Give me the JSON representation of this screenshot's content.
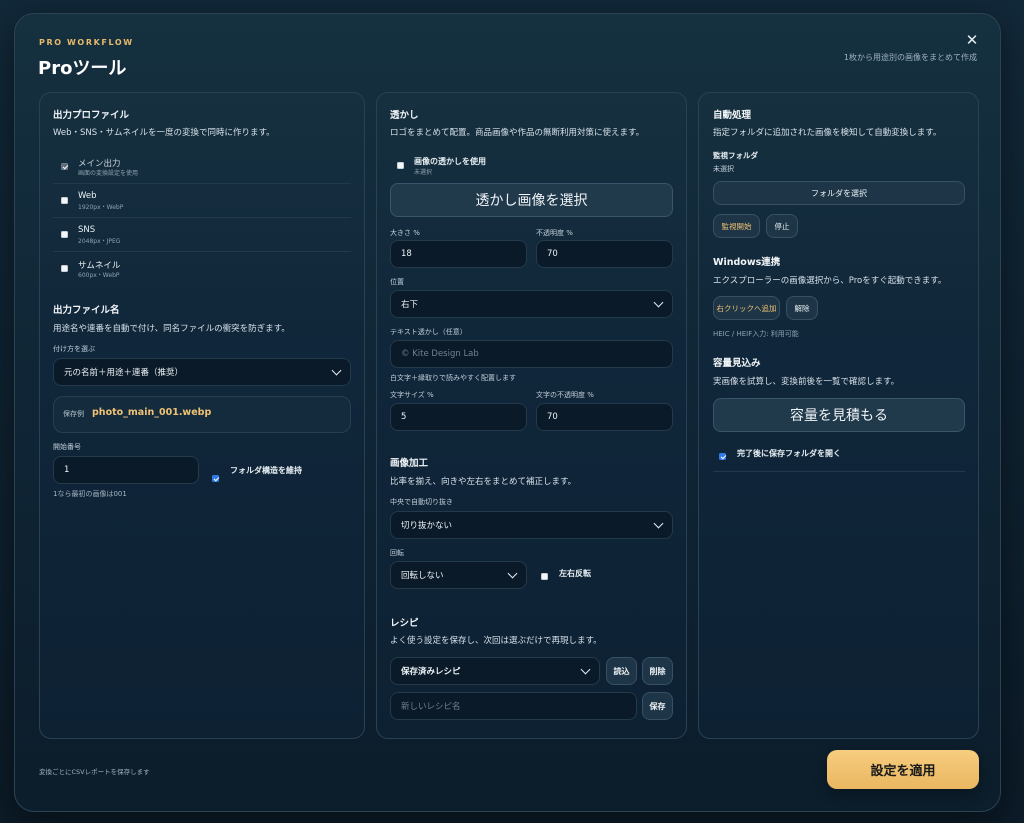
{
  "header": {
    "eyebrow": "PRO WORKFLOW",
    "title": "Proツール",
    "subtitle": "1枚から用途別の画像をまとめて作成",
    "close_icon": "close-icon",
    "close_glyph": "✕"
  },
  "output_profile": {
    "heading": "出力プロファイル",
    "description": "Web・SNS・サムネイルを一度の変換で同時に作ります。",
    "items": [
      {
        "label": "メイン出力",
        "sub": "画面の変換設定を使用",
        "checked": true,
        "disabled": true
      },
      {
        "label": "Web",
        "sub": "1920px・WebP",
        "checked": false
      },
      {
        "label": "SNS",
        "sub": "2048px・JPEG",
        "checked": false
      },
      {
        "label": "サムネイル",
        "sub": "600px・WebP",
        "checked": false
      }
    ]
  },
  "filename": {
    "heading": "出力ファイル名",
    "description": "用途名や連番を自動で付け、同名ファイルの衝突を防ぎます。",
    "method_label": "付け方を選ぶ",
    "method_value": "元の名前＋用途＋連番（推奨）",
    "example_label": "保存例",
    "example_value": "photo_main_001.webp",
    "start_label": "開始番号",
    "start_value": "1",
    "start_hint": "1なら最初の画像は001",
    "keep_structure_label": "フォルダ構造を維持",
    "keep_structure_checked": true
  },
  "watermark": {
    "heading": "透かし",
    "description": "ロゴをまとめて配置。商品画像や作品の無断利用対策に使えます。",
    "use_label": "画像の透かしを使用",
    "use_sub": "未選択",
    "select_button": "透かし画像を選択",
    "size_label": "大きさ %",
    "size_value": "18",
    "opacity_label": "不透明度 %",
    "opacity_value": "70",
    "position_label": "位置",
    "position_value": "右下",
    "text_label": "テキスト透かし（任意）",
    "text_placeholder": "© Kite Design Lab",
    "text_hint": "白文字＋縁取りで読みやすく配置します",
    "font_size_label": "文字サイズ %",
    "font_size_value": "5",
    "text_opacity_label": "文字の不透明度 %",
    "text_opacity_value": "70"
  },
  "image_processing": {
    "heading": "画像加工",
    "description": "比率を揃え、向きや左右をまとめて補正します。",
    "crop_label": "中央で自動切り抜き",
    "crop_value": "切り抜かない",
    "rotate_label": "回転",
    "rotate_value": "回転しない",
    "flip_label": "左右反転",
    "flip_checked": false
  },
  "recipe": {
    "heading": "レシピ",
    "description": "よく使う設定を保存し、次回は選ぶだけで再現します。",
    "select_value": "保存済みレシピ",
    "load_button": "読込",
    "delete_button": "削除",
    "name_placeholder": "新しいレシピ名",
    "save_button": "保存"
  },
  "auto": {
    "heading": "自動処理",
    "description": "指定フォルダに追加された画像を検知して自動変換します。",
    "watch_label": "監視フォルダ",
    "watch_value": "未選択",
    "select_folder_button": "フォルダを選択",
    "start_button": "監視開始",
    "stop_button": "停止"
  },
  "windows": {
    "heading": "Windows連携",
    "description": "エクスプローラーの画像選択から、Proをすぐ起動できます。",
    "add_button": "右クリックへ追加",
    "remove_button": "解除",
    "heic_note": "HEIC / HEIF入力: 利用可能"
  },
  "estimate": {
    "heading": "容量見込み",
    "description": "実画像を試算し、変換前後を一覧で確認します。",
    "button": "容量を見積もる",
    "open_folder_label": "完了後に保存フォルダを開く",
    "open_folder_checked": true
  },
  "footer": {
    "note": "変換ごとにCSVレポートを保存します",
    "apply_button": "設定を適用"
  },
  "colors": {
    "accent_gold": "#e7b96b",
    "apply_bg": "#f2c36f",
    "check_blue": "#2f7ae5"
  }
}
